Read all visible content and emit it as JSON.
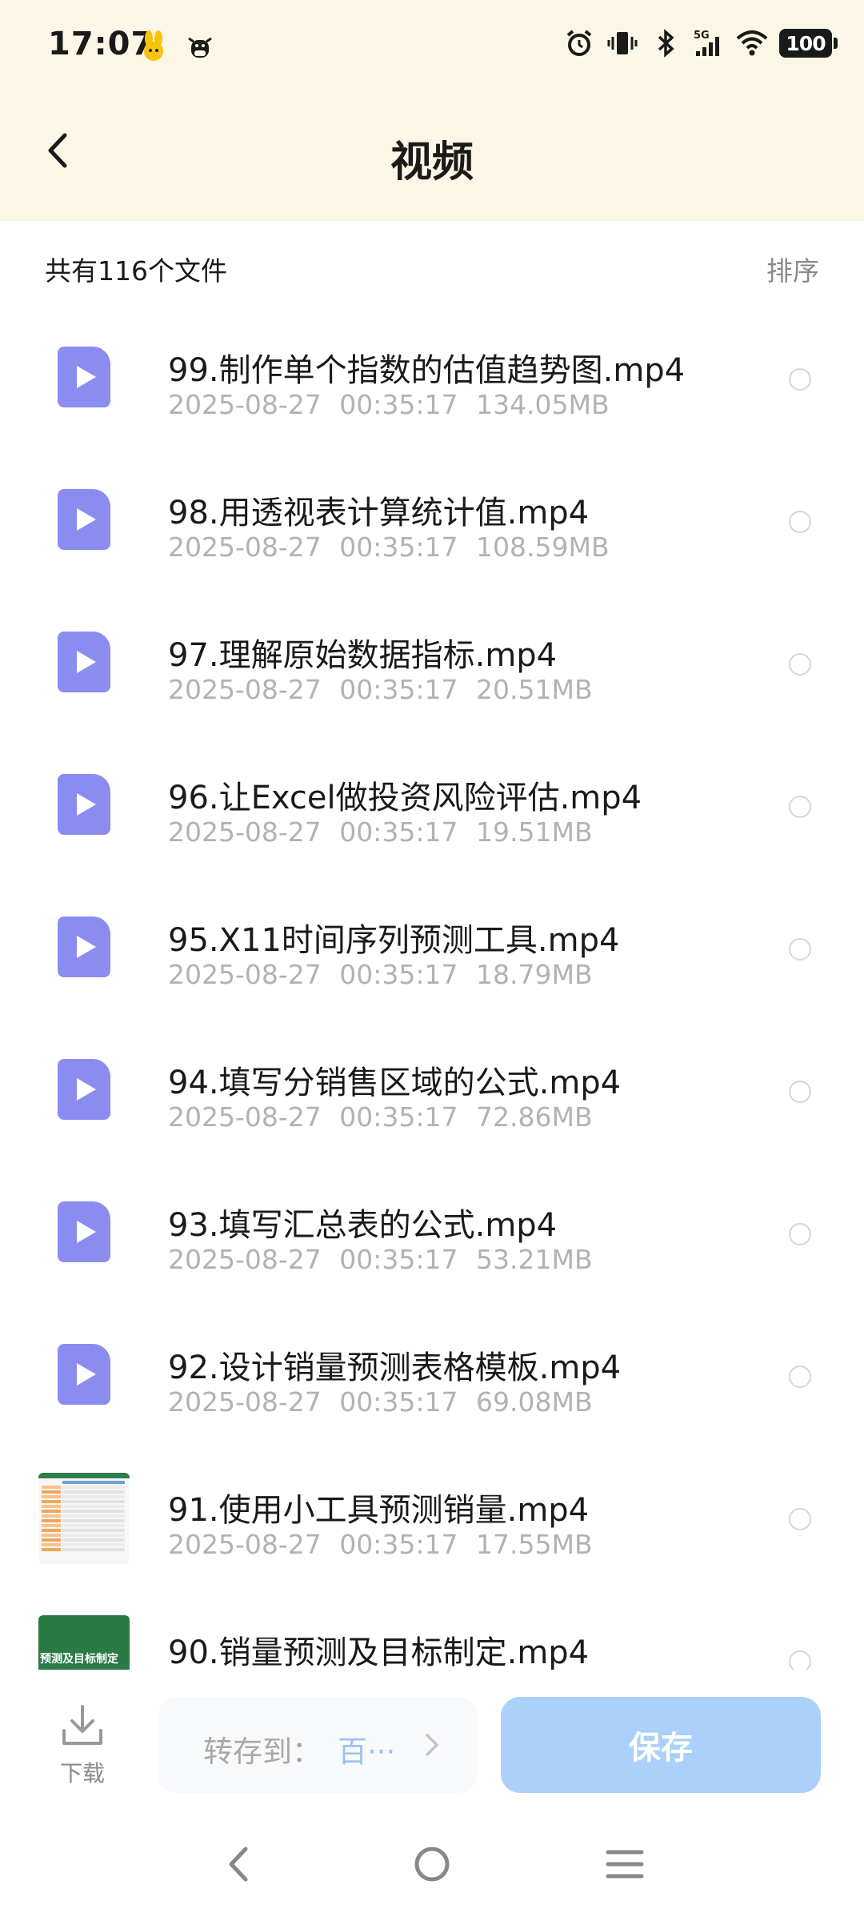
{
  "status_bar": {
    "time": "17:07",
    "battery": "100",
    "icons": [
      "bunny-emoji-icon",
      "cow-emoji-icon",
      "alarm-icon",
      "vibrate-icon",
      "bluetooth-icon",
      "signal-5g-icon",
      "wifi-icon",
      "battery-icon"
    ]
  },
  "header": {
    "title": "视频",
    "back_icon": "back-arrow-icon"
  },
  "subheader": {
    "count_text": "共有116个文件",
    "sort_label": "排序"
  },
  "files": [
    {
      "name": "99.制作单个指数的估值趋势图.mp4",
      "date": "2025-08-27",
      "time": "00:35:17",
      "size": "134.05MB",
      "thumb": "video"
    },
    {
      "name": "98.用透视表计算统计值.mp4",
      "date": "2025-08-27",
      "time": "00:35:17",
      "size": "108.59MB",
      "thumb": "video"
    },
    {
      "name": "97.理解原始数据指标.mp4",
      "date": "2025-08-27",
      "time": "00:35:17",
      "size": "20.51MB",
      "thumb": "video"
    },
    {
      "name": "96.让Excel做投资风险评估.mp4",
      "date": "2025-08-27",
      "time": "00:35:17",
      "size": "19.51MB",
      "thumb": "video"
    },
    {
      "name": "95.X11时间序列预测工具.mp4",
      "date": "2025-08-27",
      "time": "00:35:17",
      "size": "18.79MB",
      "thumb": "video"
    },
    {
      "name": "94.填写分销售区域的公式.mp4",
      "date": "2025-08-27",
      "time": "00:35:17",
      "size": "72.86MB",
      "thumb": "video"
    },
    {
      "name": "93.填写汇总表的公式.mp4",
      "date": "2025-08-27",
      "time": "00:35:17",
      "size": "53.21MB",
      "thumb": "video"
    },
    {
      "name": "92.设计销量预测表格模板.mp4",
      "date": "2025-08-27",
      "time": "00:35:17",
      "size": "69.08MB",
      "thumb": "video"
    },
    {
      "name": "91.使用小工具预测销量.mp4",
      "date": "2025-08-27",
      "time": "00:35:17",
      "size": "17.55MB",
      "thumb": "spreadsheet"
    },
    {
      "name": "90.销量预测及目标制定.mp4",
      "date": "",
      "time": "",
      "size": "",
      "thumb": "green-title",
      "thumb_text": "预测及目标制定"
    }
  ],
  "action_bar": {
    "download_label": "下载",
    "saveto_label": "转存到：",
    "saveto_value": "百···",
    "save_label": "保存"
  },
  "nav_bar": {
    "icons": [
      "nav-back-icon",
      "nav-home-icon",
      "nav-menu-icon"
    ]
  },
  "colors": {
    "header_bg": "#fcf6e6",
    "video_icon": "#8b8cf0",
    "save_button": "#abd1fa",
    "meta_text": "#b2b2b2"
  }
}
